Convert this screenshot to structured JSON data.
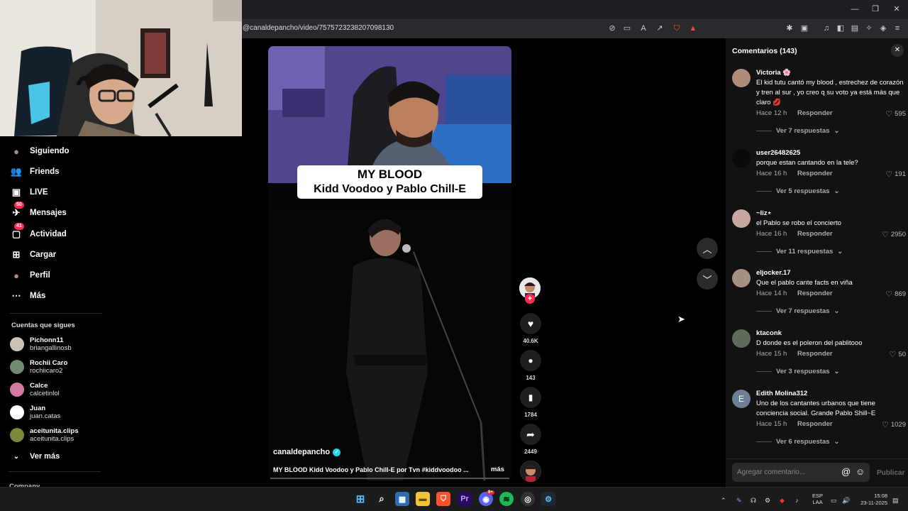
{
  "browser": {
    "url": "@canaldepancho/video/7575723238207098130"
  },
  "sidebar": {
    "items": [
      {
        "label": "Siguiendo",
        "icon": "following-avatar-icon"
      },
      {
        "label": "Friends",
        "icon": "friends-icon"
      },
      {
        "label": "LIVE",
        "icon": "live-tv-icon"
      },
      {
        "label": "Mensajes",
        "icon": "messages-icon",
        "badge": "50"
      },
      {
        "label": "Actividad",
        "icon": "activity-icon",
        "badge": "41"
      },
      {
        "label": "Cargar",
        "icon": "upload-icon"
      },
      {
        "label": "Perfil",
        "icon": "profile-avatar-icon"
      },
      {
        "label": "Más",
        "icon": "more-dots-icon"
      }
    ],
    "following_title": "Cuentas que sigues",
    "following": [
      {
        "name": "Pichonn11",
        "user": "briangallinosb",
        "color": "#c9c2b8"
      },
      {
        "name": "Rochii Caro",
        "user": "rochiicaro2",
        "color": "#6f8a70"
      },
      {
        "name": "Calce",
        "user": "calcetinlol",
        "color": "#d37aa2"
      },
      {
        "name": "Juan",
        "user": "juan.catas",
        "color": "#ffffff"
      },
      {
        "name": "aceitunita.clips",
        "user": "aceitunita.clips",
        "color": "#7a8a3a"
      }
    ],
    "see_more": "Ver más",
    "company": "Company"
  },
  "video": {
    "caption_line1": "MY BLOOD",
    "caption_line2": "Kidd Voodoo y Pablo Chill-E",
    "author": "canaldepancho",
    "description": "MY BLOOD Kidd Voodoo y Pablo Chill-E por Tvn #kiddvoodoo ...",
    "more": "más",
    "likes": "40.6K",
    "comments": "143",
    "saves": "1784",
    "shares": "2449"
  },
  "comments": {
    "title": "Comentarios (143)",
    "reply_label": "Responder",
    "input_placeholder": "Agregar comentario...",
    "post_label": "Publicar",
    "items": [
      {
        "user": "Victoria 🌸",
        "text": "El kid tutu cantó my blood , estrechez de corazón y tren al sur , yo creo q su voto ya está más que claro 💋",
        "time": "Hace 12 h",
        "likes": "595",
        "more": "Ver 7 respuestas",
        "color": "#b08a7a"
      },
      {
        "user": "user26482625",
        "text": "porque estan cantando en la tele?",
        "time": "Hace 16 h",
        "likes": "191",
        "more": "Ver 5 respuestas",
        "color": "#0a0a0a"
      },
      {
        "user": "~liz⋆",
        "text": "el Pablo se robo el concierto",
        "time": "Hace 16 h",
        "likes": "2950",
        "more": "Ver 11 respuestas",
        "color": "#c7a7a0"
      },
      {
        "user": "eljocker.17",
        "text": "Que el pablo cante facts en viña",
        "time": "Hace 14 h",
        "likes": "869",
        "more": "Ver 7 respuestas",
        "color": "#a89080"
      },
      {
        "user": "ktaconk",
        "text": "D donde es el poleron del pablitooo",
        "time": "Hace 15 h",
        "likes": "50",
        "more": "Ver 3 respuestas",
        "color": "#5e6a5a"
      },
      {
        "user": "Edith Molina312",
        "text": "Uno de los cantantes urbanos que tiene conciencia social. Grande Pablo Shill~E",
        "time": "Hace 15 h",
        "likes": "1029",
        "more": "Ver 6 respuestas",
        "color": "#6e7f95",
        "initial": "E"
      }
    ]
  },
  "taskbar": {
    "lang1": "ESP",
    "lang2": "LAA",
    "time": "15:08",
    "date": "23-11-2025",
    "discord_badge": "9+"
  }
}
